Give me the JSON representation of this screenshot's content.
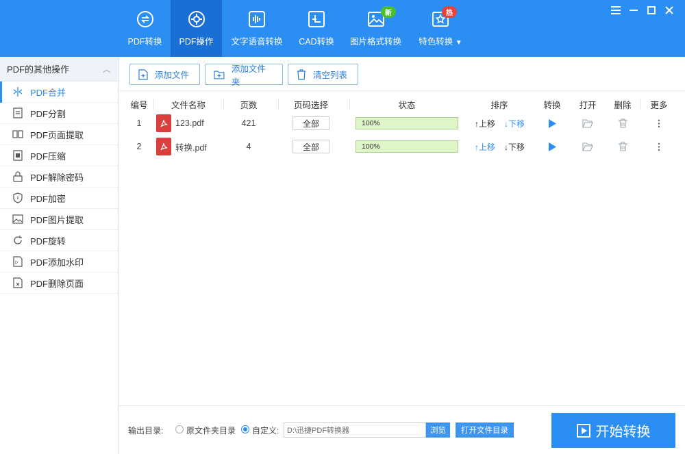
{
  "window": {
    "controls": [
      "menu-icon",
      "minimize-icon",
      "maximize-icon",
      "close-icon"
    ]
  },
  "nav": {
    "tabs": [
      {
        "label": "PDF转换",
        "icon": "convert-icon"
      },
      {
        "label": "PDF操作",
        "icon": "gear-icon",
        "active": true
      },
      {
        "label": "文字语音转换",
        "icon": "audio-wave-icon"
      },
      {
        "label": "CAD转换",
        "icon": "cad-icon"
      },
      {
        "label": "图片格式转换",
        "icon": "image-icon",
        "badge": "新"
      },
      {
        "label": "特色转换",
        "icon": "star-icon",
        "badge": "热"
      }
    ]
  },
  "sidebar": {
    "title": "PDF的其他操作",
    "items": [
      {
        "label": "PDF合并",
        "icon": "merge-icon",
        "active": true
      },
      {
        "label": "PDF分割",
        "icon": "split-icon"
      },
      {
        "label": "PDF页面提取",
        "icon": "page-extract-icon"
      },
      {
        "label": "PDF压缩",
        "icon": "compress-icon"
      },
      {
        "label": "PDF解除密码",
        "icon": "unlock-icon"
      },
      {
        "label": "PDF加密",
        "icon": "shield-icon"
      },
      {
        "label": "PDF图片提取",
        "icon": "image-extract-icon"
      },
      {
        "label": "PDF旋转",
        "icon": "rotate-icon"
      },
      {
        "label": "PDF添加水印",
        "icon": "watermark-icon"
      },
      {
        "label": "PDF删除页面",
        "icon": "delete-page-icon"
      }
    ]
  },
  "toolbar": {
    "add_file": "添加文件",
    "add_folder": "添加文件夹",
    "clear_list": "清空列表"
  },
  "table": {
    "headers": {
      "no": "编号",
      "name": "文件名称",
      "pages": "页数",
      "page_select": "页码选择",
      "status": "状态",
      "sort": "排序",
      "convert": "转换",
      "open": "打开",
      "delete": "删除",
      "more": "更多"
    },
    "rows": [
      {
        "no": "1",
        "name": "123.pdf",
        "pages": "421",
        "page_select": "全部",
        "progress": "100%",
        "progress_value": 100,
        "up": "↑上移",
        "down": "↓下移"
      },
      {
        "no": "2",
        "name": "转换.pdf",
        "pages": "4",
        "page_select": "全部",
        "progress": "100%",
        "progress_value": 100,
        "up": "↑上移",
        "down": "↓下移"
      }
    ]
  },
  "footer": {
    "output_label": "输出目录:",
    "option_original": "原文件夹目录",
    "option_custom": "自定义:",
    "path_value": "D:\\迅捷PDF转换器",
    "browse": "浏览",
    "open_dir": "打开文件目录",
    "start": "开始转换"
  },
  "colors": {
    "brand": "#2a8ef3",
    "active_tab": "#1a6fd4",
    "badge_new": "#4bbf2a",
    "badge_hot": "#e8423b",
    "progress_fill": "#ddf5c7",
    "pdf_icon": "#d9403d"
  }
}
